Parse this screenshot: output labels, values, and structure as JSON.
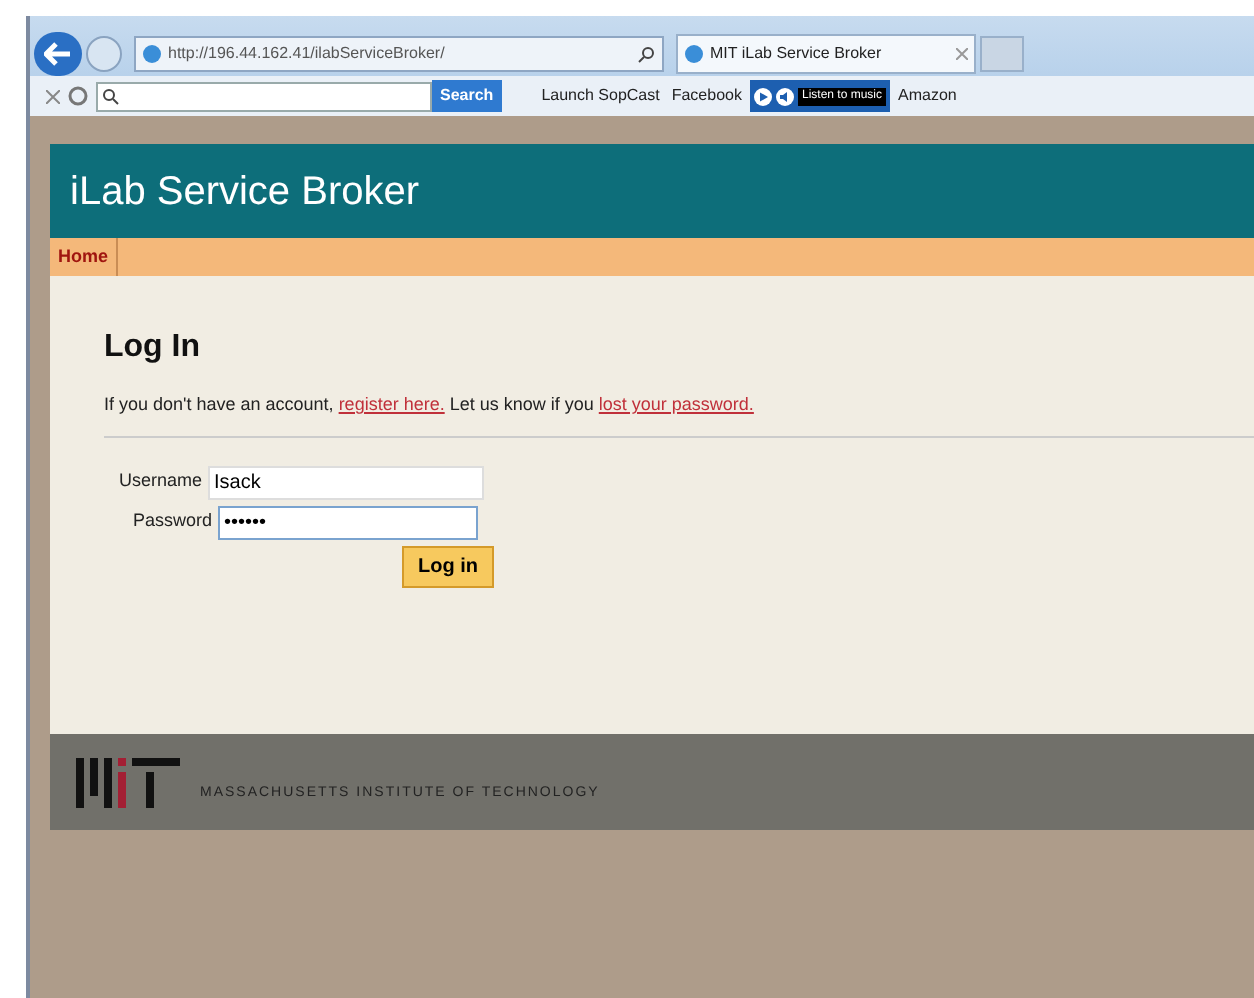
{
  "browser": {
    "address": "http://196.44.162.41/ilabServiceBroker/",
    "tab_title": "MIT iLab Service Broker",
    "search_button": "Search",
    "toolbar_items": [
      "Launch SopCast",
      "Facebook"
    ],
    "music_label": "Listen to music",
    "amazon": "Amazon"
  },
  "site": {
    "title": "iLab Service Broker",
    "nav": [
      {
        "label": "Home",
        "selected": true
      }
    ]
  },
  "login": {
    "heading": "Log In",
    "intro": [
      "If you don't have an account, ",
      "register here.",
      " Let us know if you ",
      "lost your password."
    ],
    "fields": [
      {
        "label": "Username",
        "value": "Isack",
        "kind": "text"
      },
      {
        "label": "Password",
        "value": "••••••",
        "kind": "password"
      }
    ],
    "button": "Log in"
  },
  "footer": {
    "org": "MASSACHUSETTS INSTITUTE OF TECHNOLOGY"
  }
}
